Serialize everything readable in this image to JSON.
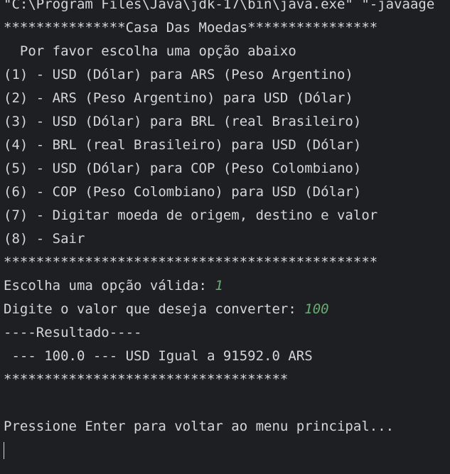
{
  "console": {
    "command": "\"C:\\Program Files\\Java\\jdk-17\\bin\\java.exe\" \"-javaage",
    "header": "***************Casa Das Moedas****************",
    "prompt": "  Por favor escolha uma opção abaixo",
    "options": [
      "(1) - USD (Dólar) para ARS (Peso Argentino)",
      "(2) - ARS (Peso Argentino) para USD (Dólar)",
      "(3) - USD (Dólar) para BRL (real Brasileiro)",
      "(4) - BRL (real Brasileiro) para USD (Dólar)",
      "(5) - USD (Dólar) para COP (Peso Colombiano)",
      "(6) - COP (Peso Colombiano) para USD (Dólar)",
      "(7) - Digitar moeda de origem, destino e valor",
      "(8) - Sair"
    ],
    "separator": "**********************************************",
    "choice_label": "Escolha uma opção válida: ",
    "choice_value": "1",
    "amount_label": "Digite o valor que deseja converter: ",
    "amount_value": "100",
    "result_header": "----Resultado----",
    "result_line": " --- 100.0 --- USD Igual a 91592.0 ARS",
    "result_separator": "***********************************",
    "blank": "",
    "enter_prompt": "Pressione Enter para voltar ao menu principal..."
  }
}
